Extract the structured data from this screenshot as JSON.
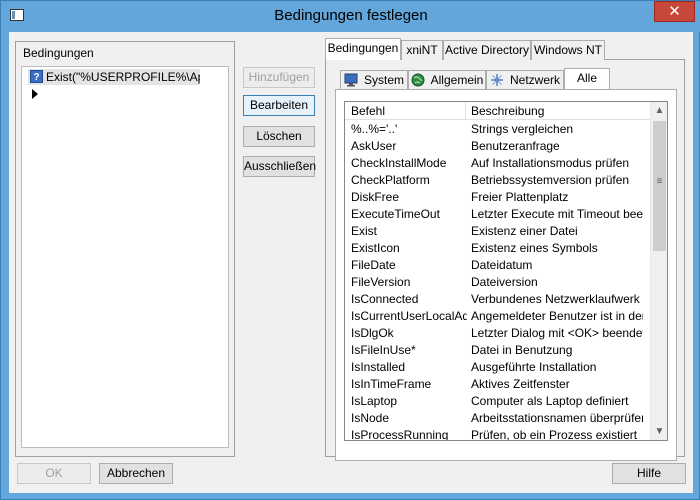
{
  "window": {
    "title": "Bedingungen festlegen",
    "close_glyph": "✕"
  },
  "left_group": {
    "label": "Bedingungen",
    "conditions": [
      {
        "icon": "question-icon",
        "glyph": "?",
        "text": "Exist(\"%USERPROFILE%\\AppD..."
      }
    ]
  },
  "actions": {
    "add": "Hinzufügen",
    "edit": "Bearbeiten",
    "delete": "Löschen",
    "exclude": "Ausschließen"
  },
  "outer_tabs": [
    {
      "label": "Bedingungen",
      "active": true
    },
    {
      "label": "xniNT",
      "active": false
    },
    {
      "label": "Active Directory",
      "active": false
    },
    {
      "label": "Windows NT",
      "active": false
    }
  ],
  "inner_tabs": [
    {
      "label": "System",
      "icon": "monitor-icon",
      "active": false
    },
    {
      "label": "Allgemein",
      "icon": "globe-icon",
      "active": false
    },
    {
      "label": "Netzwerk",
      "icon": "network-icon",
      "active": false
    },
    {
      "label": "Alle",
      "icon": "",
      "active": true
    }
  ],
  "table": {
    "columns": [
      "Befehl",
      "Beschreibung"
    ],
    "rows": [
      [
        "%..%='..'",
        "Strings vergleichen"
      ],
      [
        "AskUser",
        "Benutzeranfrage"
      ],
      [
        "CheckInstallMode",
        "Auf Installationsmodus prüfen"
      ],
      [
        "CheckPlatform",
        "Betriebssystemversion prüfen"
      ],
      [
        "DiskFree",
        "Freier Plattenplatz"
      ],
      [
        "ExecuteTimeOut",
        "Letzter Execute mit Timeout been..."
      ],
      [
        "Exist",
        "Existenz einer Datei"
      ],
      [
        "ExistIcon",
        "Existenz eines Symbols"
      ],
      [
        "FileDate",
        "Dateidatum"
      ],
      [
        "FileVersion",
        "Dateiversion"
      ],
      [
        "IsConnected",
        "Verbundenes Netzwerklaufwerk"
      ],
      [
        "IsCurrentUserLocalAd...",
        "Angemeldeter Benutzer ist in der ..."
      ],
      [
        "IsDlgOk",
        "Letzter Dialog mit <OK> beendet"
      ],
      [
        "IsFileInUse*",
        "Datei in Benutzung"
      ],
      [
        "IsInstalled",
        "Ausgeführte Installation"
      ],
      [
        "IsInTimeFrame",
        "Aktives Zeitfenster"
      ],
      [
        "IsLaptop",
        "Computer als Laptop definiert"
      ],
      [
        "IsNode",
        "Arbeitsstationsnamen überprüfen"
      ],
      [
        "IsProcessRunning",
        "Prüfen, ob ein Prozess existiert"
      ]
    ]
  },
  "footer": {
    "ok": "OK",
    "cancel": "Abbrechen",
    "help": "Hilfe"
  }
}
